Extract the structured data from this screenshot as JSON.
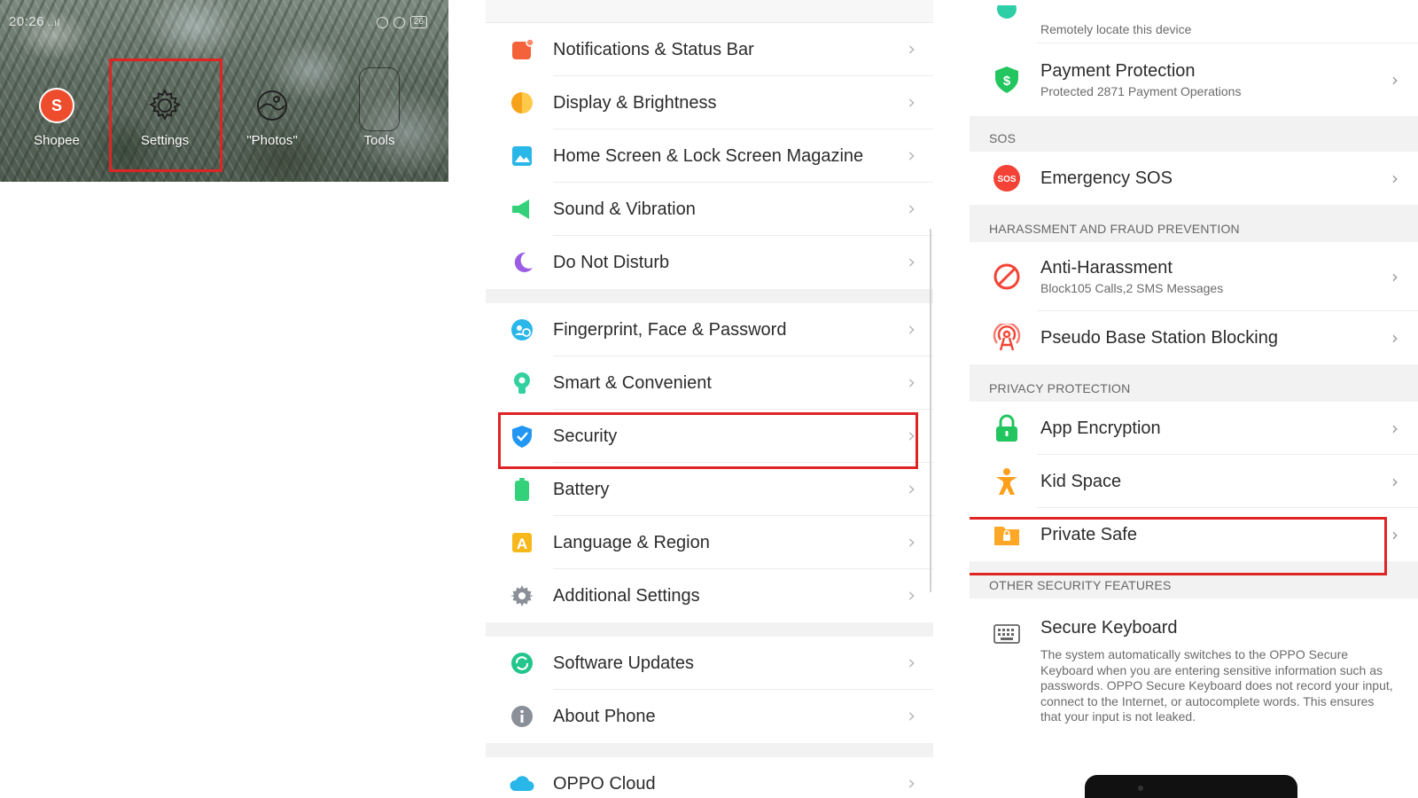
{
  "home": {
    "status_time": "20:26",
    "status_signal": "..ıl",
    "status_battery": "26",
    "apps": [
      {
        "label": "Shopee",
        "icon": "shopee-bag-icon"
      },
      {
        "label": "Settings",
        "icon": "gear-icon"
      },
      {
        "label": "\"Photos\"",
        "icon": "photos-icon"
      },
      {
        "label": "Tools",
        "icon": "folder-icon"
      }
    ]
  },
  "settings": {
    "group1": [
      {
        "label": "Notifications & Status Bar",
        "icon": "notifications-icon",
        "color": "#f4623a"
      },
      {
        "label": "Display & Brightness",
        "icon": "brightness-icon",
        "color": "#f7a21b"
      },
      {
        "label": "Home Screen & Lock Screen Magazine",
        "icon": "home-screen-icon",
        "color": "#29b6e8"
      },
      {
        "label": "Sound & Vibration",
        "icon": "sound-icon",
        "color": "#33d17a"
      },
      {
        "label": "Do Not Disturb",
        "icon": "moon-icon",
        "color": "#9b5de5"
      }
    ],
    "group2": [
      {
        "label": "Fingerprint, Face & Password",
        "icon": "fingerprint-icon",
        "color": "#29b6e8"
      },
      {
        "label": "Smart & Convenient",
        "icon": "smart-icon",
        "color": "#33d1a0"
      },
      {
        "label": "Security",
        "icon": "security-shield-icon",
        "color": "#2196f3"
      },
      {
        "label": "Battery",
        "icon": "battery-icon",
        "color": "#33d17a"
      },
      {
        "label": "Language & Region",
        "icon": "language-icon",
        "color": "#f7b81b"
      },
      {
        "label": "Additional Settings",
        "icon": "gear-icon",
        "color": "#8a8f98"
      }
    ],
    "group3": [
      {
        "label": "Software Updates",
        "icon": "update-icon",
        "color": "#22c58b"
      },
      {
        "label": "About Phone",
        "icon": "info-icon",
        "color": "#8a8f98"
      }
    ],
    "group4": [
      {
        "label": "OPPO Cloud",
        "icon": "cloud-icon",
        "color": "#29b6e8"
      }
    ]
  },
  "security": {
    "find_device_sub": "Remotely locate this device",
    "payment": {
      "title": "Payment Protection",
      "sub": "Protected 2871 Payment Operations"
    },
    "sos_header": "SOS",
    "sos": {
      "title": "Emergency SOS",
      "badge": "SOS"
    },
    "harassment_header": "HARASSMENT AND FRAUD PREVENTION",
    "anti": {
      "title": "Anti-Harassment",
      "sub": "Block105 Calls,2 SMS Messages"
    },
    "pseudo": {
      "title": "Pseudo Base Station Blocking"
    },
    "privacy_header": "PRIVACY PROTECTION",
    "app_encryption": {
      "title": "App Encryption"
    },
    "kid_space": {
      "title": "Kid Space"
    },
    "private_safe": {
      "title": "Private Safe"
    },
    "other_header": "OTHER SECURITY FEATURES",
    "keyboard": {
      "title": "Secure Keyboard",
      "desc": "The system automatically switches to the OPPO Secure Keyboard when you are entering sensitive information such as passwords. OPPO Secure Keyboard does not record your input, connect to the Internet, or autocomplete words. This ensures that your input is not leaked."
    }
  },
  "chevron": "›",
  "highlight_color": "#e02424"
}
